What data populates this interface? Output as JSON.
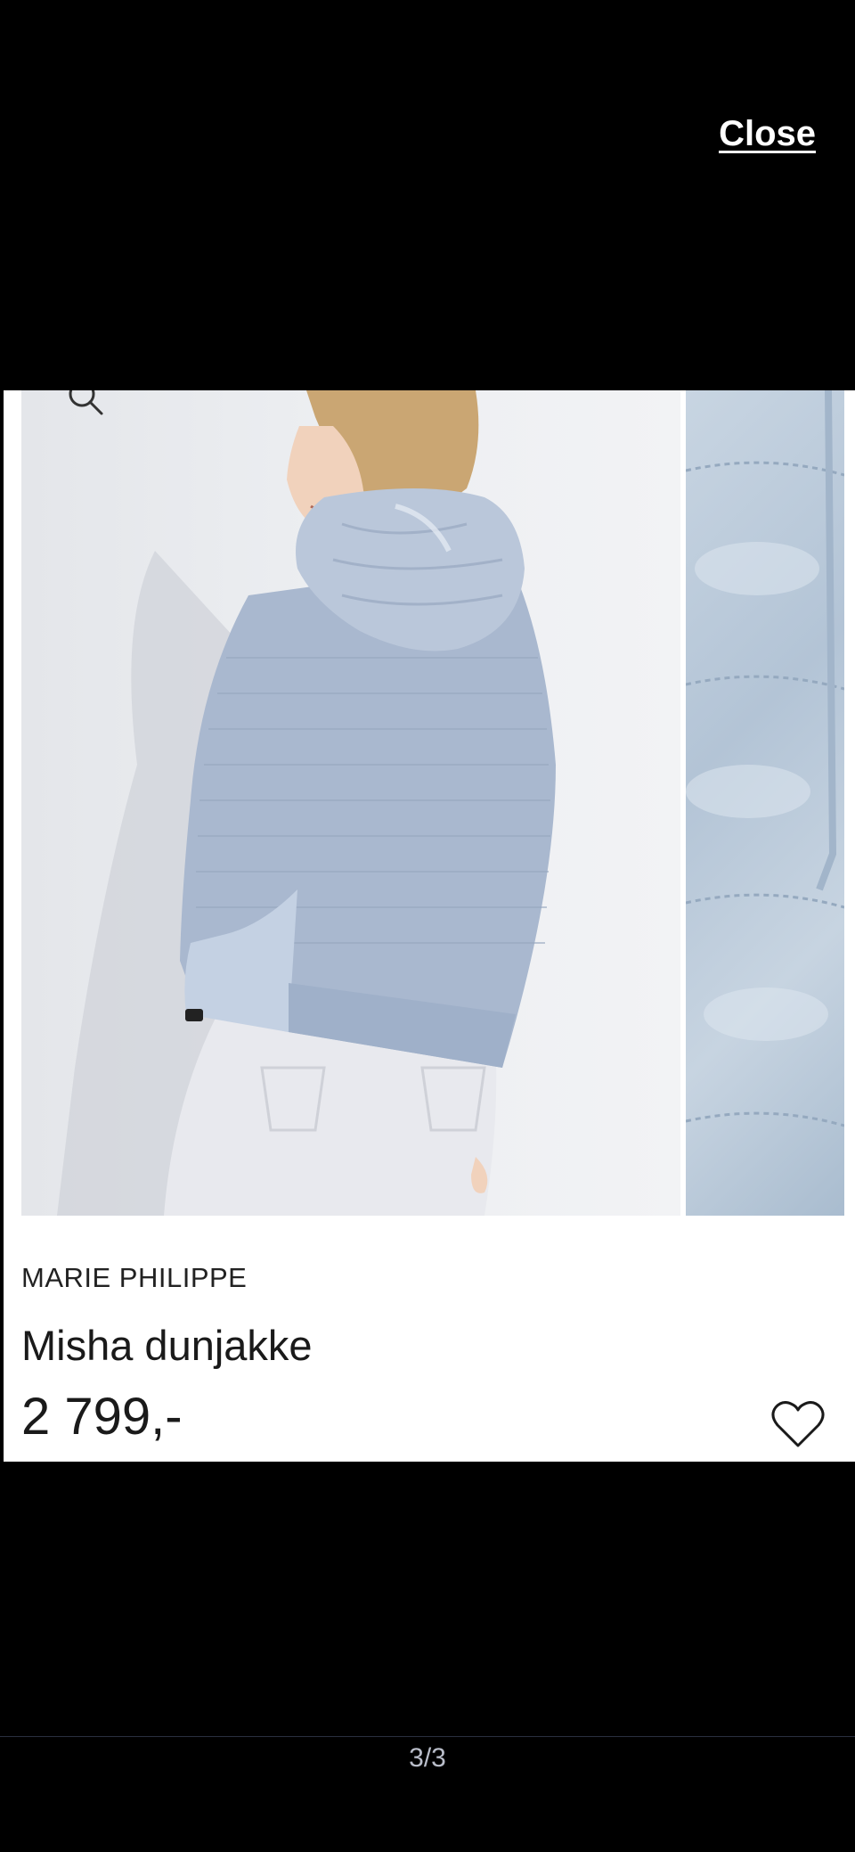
{
  "header": {
    "close_label": "Close"
  },
  "product": {
    "brand": "MARIE PHILIPPE",
    "name": "Misha dunjakke",
    "price": "2 799,-",
    "images": [
      "main-photo",
      "detail-photo"
    ]
  },
  "icons": {
    "zoom": "magnifier-icon",
    "favorite": "heart-icon"
  },
  "pager": {
    "indicator": "3/3"
  },
  "colors": {
    "background": "#000000",
    "card": "#ffffff",
    "jacket": "#a9b8cf"
  }
}
